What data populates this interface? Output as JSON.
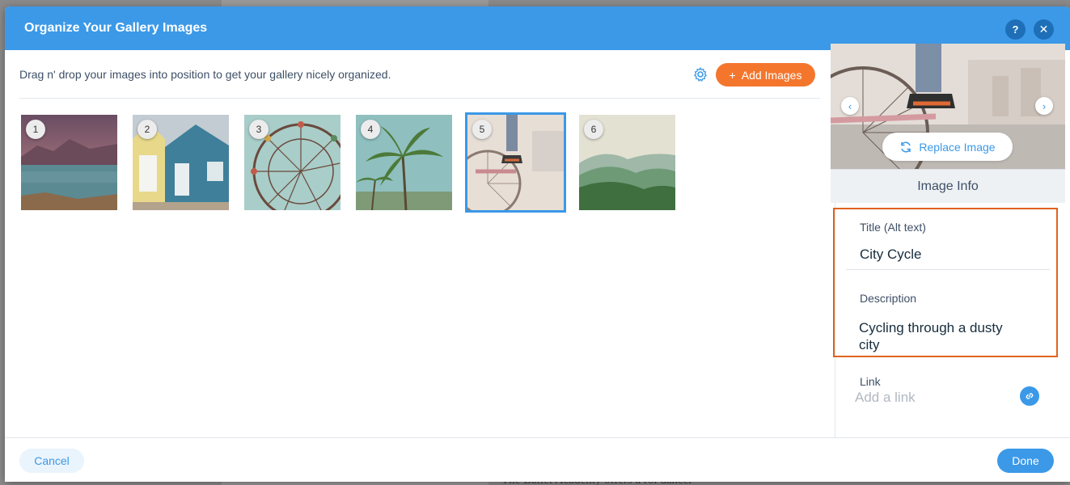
{
  "background": {
    "text": "The Ballet Academy offers a rol dancer"
  },
  "dialog": {
    "title": "Organize Your Gallery Images",
    "help_label": "?",
    "close_label": "✕"
  },
  "toolbar": {
    "instructions": "Drag n' drop your images into position to get your gallery nicely organized.",
    "add_images_label": "Add Images",
    "add_images_icon": "+"
  },
  "gallery": {
    "items": [
      {
        "number": "1",
        "subject": "lake and mountains"
      },
      {
        "number": "2",
        "subject": "beach huts"
      },
      {
        "number": "3",
        "subject": "ferris wheel"
      },
      {
        "number": "4",
        "subject": "palm trees"
      },
      {
        "number": "5",
        "subject": "bicycle",
        "selected": true
      },
      {
        "number": "6",
        "subject": "green hills"
      }
    ]
  },
  "panel": {
    "prev_label": "‹",
    "next_label": "›",
    "replace_label": "Replace Image",
    "section_title": "Image Info",
    "title_label": "Title (Alt text)",
    "title_value": "City Cycle",
    "description_label": "Description",
    "description_value": "Cycling through a dusty city",
    "link_label": "Link",
    "link_placeholder": "Add a link"
  },
  "footer": {
    "cancel_label": "Cancel",
    "done_label": "Done"
  },
  "colors": {
    "accent": "#3b99e8",
    "add_button": "#f4762d",
    "highlight_border": "#e0621f"
  }
}
